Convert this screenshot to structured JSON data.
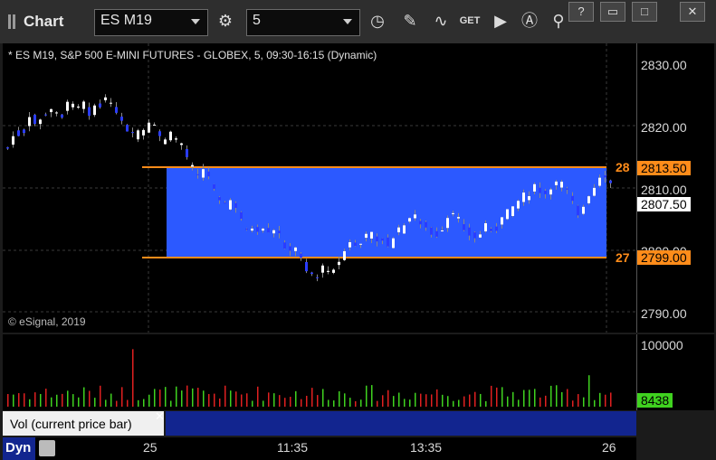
{
  "window": {
    "title": "Chart",
    "buttons": [
      "?",
      "",
      "",
      "✕"
    ]
  },
  "toolbar": {
    "symbol": "ES M19",
    "interval": "5"
  },
  "chart": {
    "study_title": "* ES M19, S&P 500 E-MINI FUTURES - GLOBEX, 5, 09:30-16:15 (Dynamic)",
    "copyright": "© eSignal, 2019",
    "price_labels": [
      "2830.00",
      "2820.00",
      "2810.00",
      "2800.00",
      "2790.00"
    ],
    "range_high": {
      "label": "28",
      "price": "2813.50"
    },
    "range_low": {
      "label": "27",
      "price": "2799.00"
    },
    "last_price": "2807.50",
    "colors": {
      "range_fill": "#2c59ff",
      "range_line": "#ff8c1a",
      "up": "#ffffff",
      "down": "#2a3cff"
    }
  },
  "volume": {
    "panel_label": "Vol (current price bar)",
    "axis_label": "100000",
    "current": "8438"
  },
  "time_axis": {
    "prefix": "Dyn",
    "labels": [
      "25",
      "11:35",
      "13:35",
      "26"
    ]
  }
}
